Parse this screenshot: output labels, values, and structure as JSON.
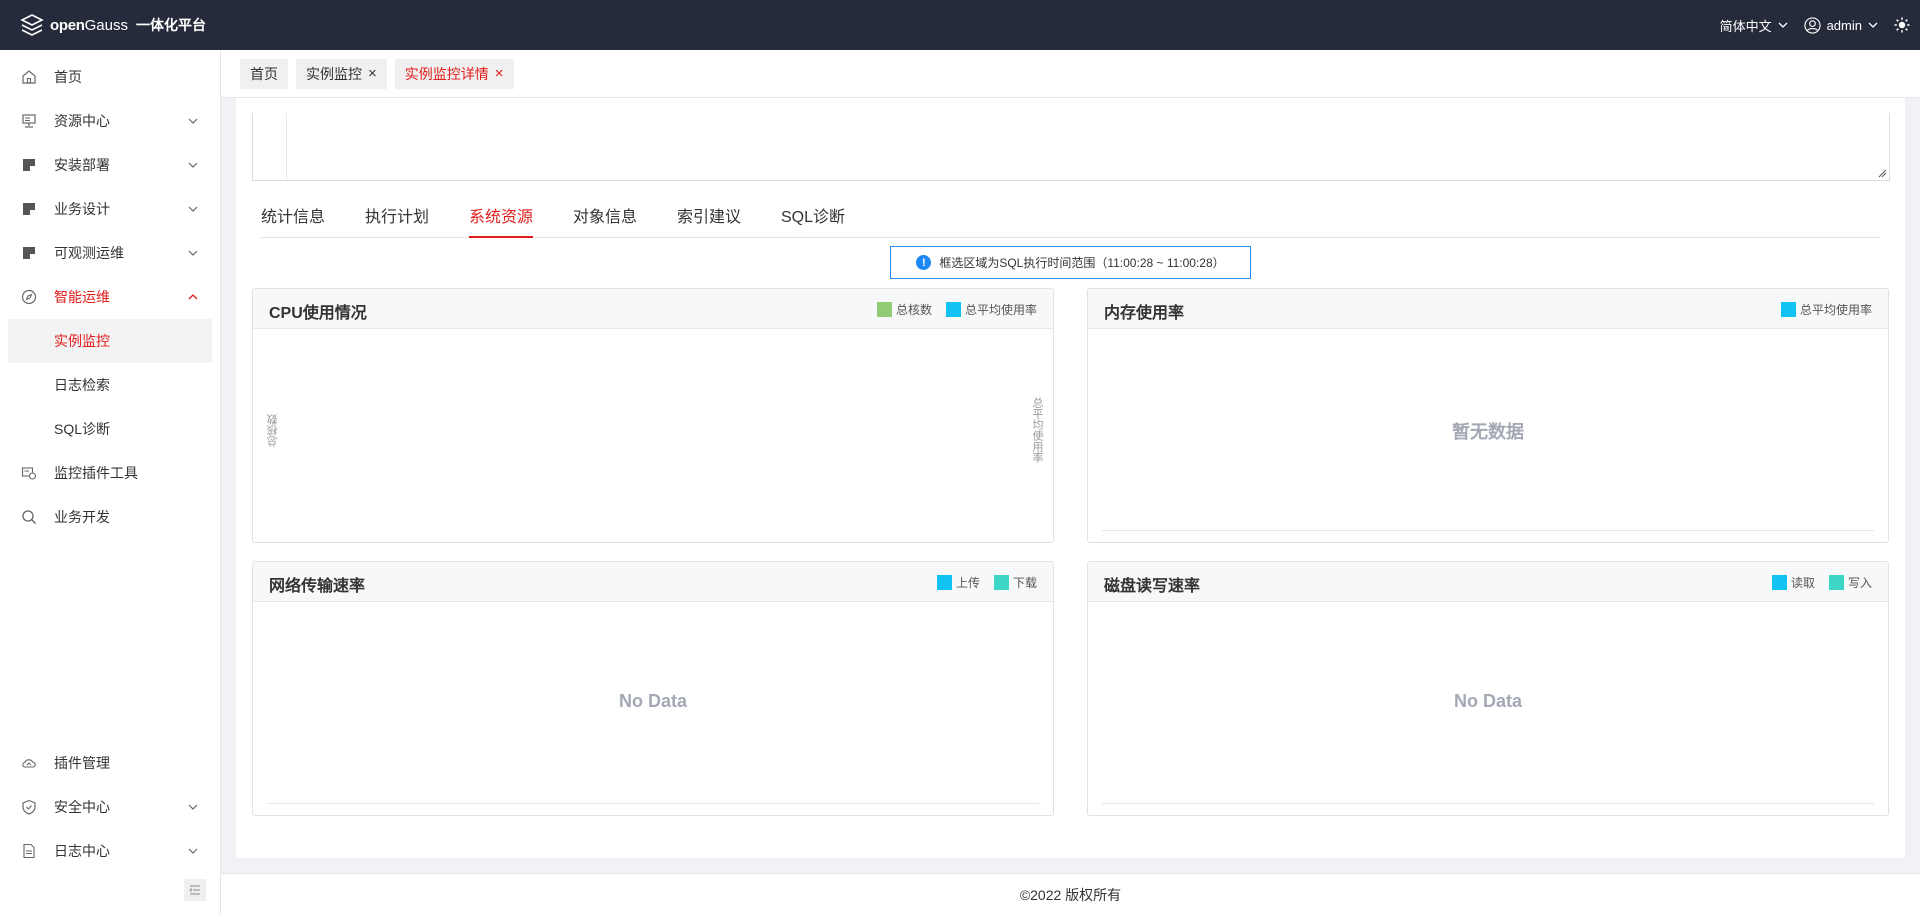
{
  "header": {
    "brand_open": "open",
    "brand_gauss": "Gauss",
    "brand_sub": "一体化平台",
    "language": "简体中文",
    "user": "admin"
  },
  "sidebar": {
    "items": [
      {
        "label": "首页"
      },
      {
        "label": "资源中心"
      },
      {
        "label": "安装部署"
      },
      {
        "label": "业务设计"
      },
      {
        "label": "可观测运维"
      },
      {
        "label": "智能运维"
      },
      {
        "label": "实例监控"
      },
      {
        "label": "日志检索"
      },
      {
        "label": "SQL诊断"
      },
      {
        "label": "监控插件工具"
      },
      {
        "label": "业务开发"
      },
      {
        "label": "插件管理"
      },
      {
        "label": "安全中心"
      },
      {
        "label": "日志中心"
      }
    ]
  },
  "page_tabs": [
    {
      "label": "首页"
    },
    {
      "label": "实例监控",
      "close": "×"
    },
    {
      "label": "实例监控详情",
      "close": "×"
    }
  ],
  "sub_tabs": [
    "统计信息",
    "执行计划",
    "系统资源",
    "对象信息",
    "索引建议",
    "SQL诊断"
  ],
  "active_sub_tab": "系统资源",
  "notice": {
    "icon": "!",
    "text": "框选区域为SQL执行时间范围（11:00:28 ~ 11:00:28）"
  },
  "colors": {
    "accent": "#e41d1d",
    "topbar": "#252b3a",
    "series_green": "#91cc75",
    "series_blue": "#13c2f5",
    "series_teal": "#3dd5c8"
  },
  "cards": {
    "cpu": {
      "title": "CPU使用情况",
      "legend": [
        "总核数",
        "总平均使用率"
      ],
      "y_left": "总核数",
      "y_right": "总平均使用率"
    },
    "memory": {
      "title": "内存使用率",
      "legend": [
        "总平均使用率"
      ],
      "empty": "暂无数据"
    },
    "network": {
      "title": "网络传输速率",
      "legend": [
        "上传",
        "下载"
      ],
      "empty": "No Data"
    },
    "disk": {
      "title": "磁盘读写速率",
      "legend": [
        "读取",
        "写入"
      ],
      "empty": "No Data"
    }
  },
  "footer": "©2022 版权所有"
}
